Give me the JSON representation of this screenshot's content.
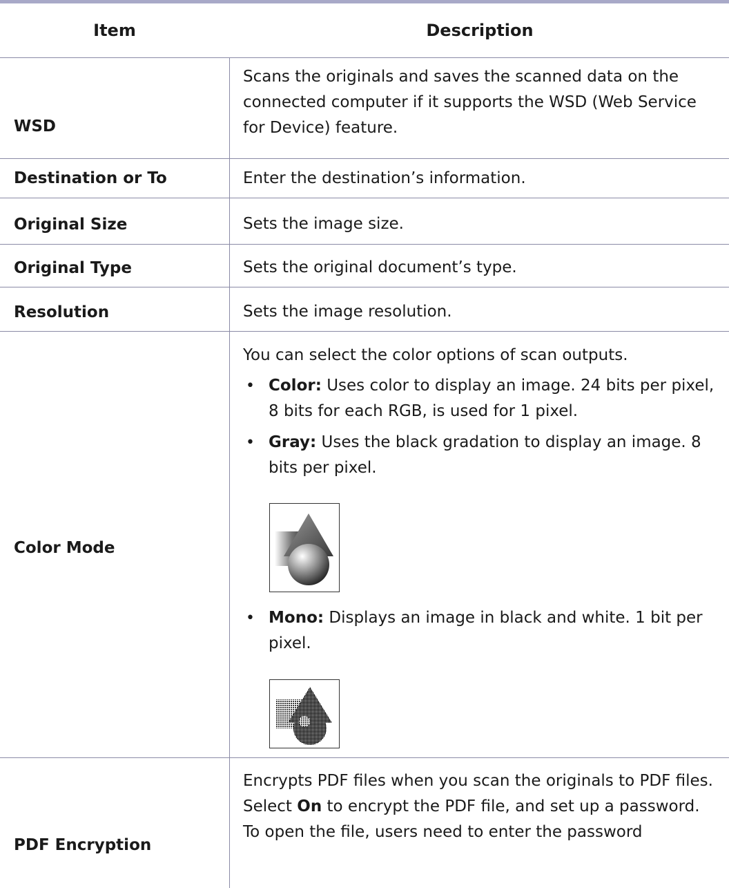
{
  "header": {
    "item": "Item",
    "description": "Description"
  },
  "rows": [
    {
      "item": "WSD",
      "description": " Scans the originals and saves the scanned data on the connected computer if it supports the WSD (Web Service for Device) feature."
    },
    {
      "item": "Destination or To",
      "description": "Enter the destination’s information."
    },
    {
      "item": "Original Size",
      "description": "Sets the image size."
    },
    {
      "item": "Original Type",
      "description": "Sets the original document’s type."
    },
    {
      "item": "Resolution",
      "description": "Sets the image resolution."
    },
    {
      "item": "Color Mode",
      "intro": "You can select the color options of scan outputs.",
      "options": [
        {
          "bullet": "•",
          "label": "Color:",
          "text": " Uses color to display an image. 24 bits per pixel, 8 bits for each RGB, is used for 1 pixel."
        },
        {
          "bullet": "•",
          "label": "Gray:",
          "text": " Uses the black gradation to display an image. 8 bits per pixel."
        },
        {
          "bullet": "•",
          "label": "Mono:",
          "text": "  Displays an image in black and white. 1 bit per pixel."
        }
      ]
    },
    {
      "item": "PDF Encryption",
      "desc_before": "Encrypts PDF files when you scan the originals to PDF files. Select ",
      "desc_bold": "On",
      "desc_after": " to encrypt the PDF file, and set up a password. To open the file, users need to enter the password"
    }
  ]
}
